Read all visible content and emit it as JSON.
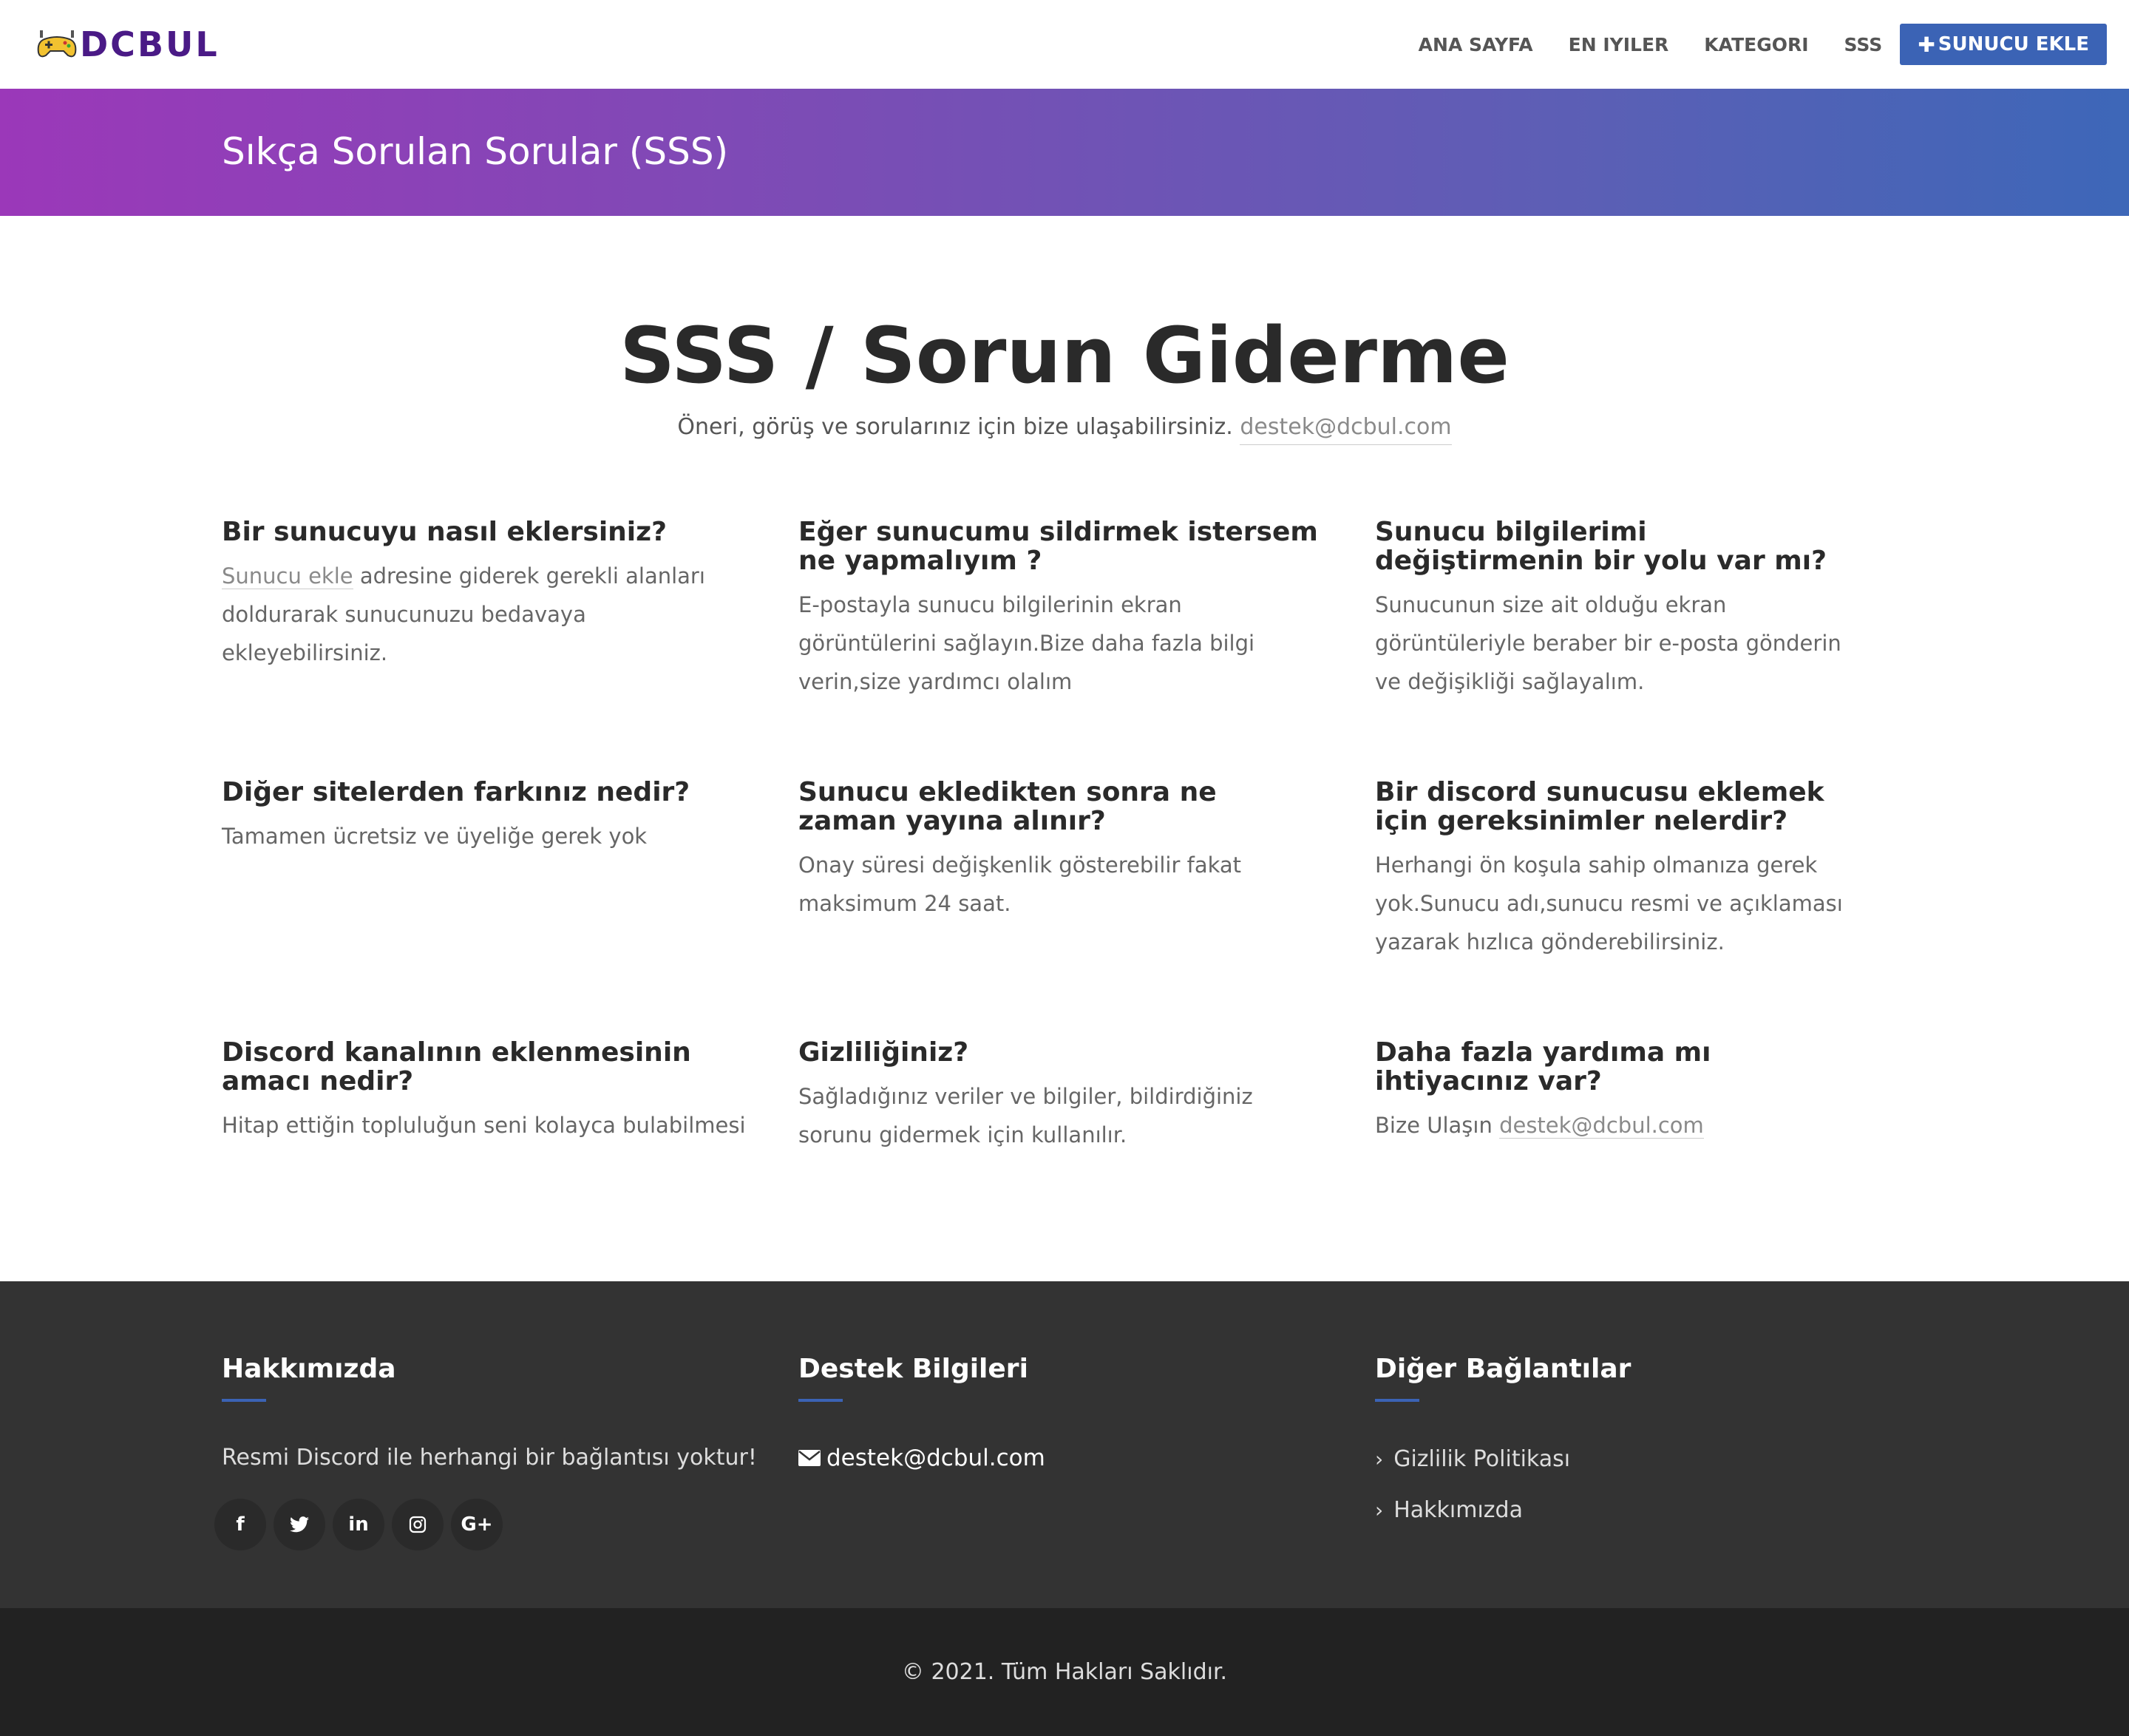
{
  "brand": {
    "logo_text": "DCBUL"
  },
  "nav": {
    "items": [
      "ANA SAYFA",
      "EN IYILER",
      "KATEGORI",
      "SSS"
    ],
    "cta_label": "SUNUCU EKLE"
  },
  "hero": {
    "title": "Sıkça Sorulan Sorular (SSS)"
  },
  "main": {
    "title": "SSS / Sorun Giderme",
    "subtitle": "Öneri, görüş ve sorularınız için bize ulaşabilirsiniz.",
    "email": "destek@dcbul.com"
  },
  "faqs": [
    {
      "q": "Bir sunucuyu nasıl eklersiniz?",
      "link": "Sunucu ekle",
      "a": " adresine giderek gerekli alanları doldurarak sunucunuzu bedavaya ekleyebilirsiniz."
    },
    {
      "q": "Eğer sunucumu sildirmek istersem ne yapmalıyım ?",
      "a": "E-postayla sunucu bilgilerinin ekran görüntülerini sağlayın.Bize daha fazla bilgi verin,size yardımcı olalım"
    },
    {
      "q": "Sunucu bilgilerimi değiştirmenin bir yolu var mı?",
      "a": "Sunucunun size ait olduğu ekran görüntüleriyle beraber bir e-posta gönderin ve değişikliği sağlayalım."
    },
    {
      "q": "Diğer sitelerden farkınız nedir?",
      "a": "Tamamen ücretsiz ve üyeliğe gerek yok"
    },
    {
      "q": "Sunucu ekledikten sonra ne zaman yayına alınır?",
      "a": "Onay süresi değişkenlik gösterebilir fakat maksimum 24 saat."
    },
    {
      "q": "Bir discord sunucusu eklemek için gereksinimler nelerdir?",
      "a": "Herhangi ön koşula sahip olmanıza gerek yok.Sunucu adı,sunucu resmi ve açıklaması yazarak hızlıca gönderebilirsiniz."
    },
    {
      "q": "Discord kanalının eklenmesinin amacı nedir?",
      "a": "Hitap ettiğin topluluğun seni kolayca bulabilmesi"
    },
    {
      "q": "Gizliliğiniz?",
      "a": "Sağladığınız veriler ve bilgiler, bildirdiğiniz sorunu gidermek için kullanılır."
    },
    {
      "q": "Daha fazla yardıma mı ihtiyacınız var?",
      "a": "Bize Ulaşın ",
      "link": "destek@dcbul.com"
    }
  ],
  "footer": {
    "about_title": "Hakkımızda",
    "about_text": "Resmi Discord ile herhangi bir bağlantısı yoktur!",
    "social_icons": [
      "facebook-icon",
      "twitter-icon",
      "linkedin-icon",
      "instagram-icon",
      "google-plus-icon"
    ],
    "support_title": "Destek Bilgileri",
    "support_email": "destek@dcbul.com",
    "links_title": "Diğer Bağlantılar",
    "links": [
      "Gizlilik Politikası",
      "Hakkımızda"
    ],
    "copyright": "© 2021. Tüm Hakları Saklıdır."
  },
  "colors": {
    "accent": "#3b63b5",
    "brand": "#4a1a86",
    "footer_bg": "#333333",
    "bottom_bg": "#222222"
  }
}
